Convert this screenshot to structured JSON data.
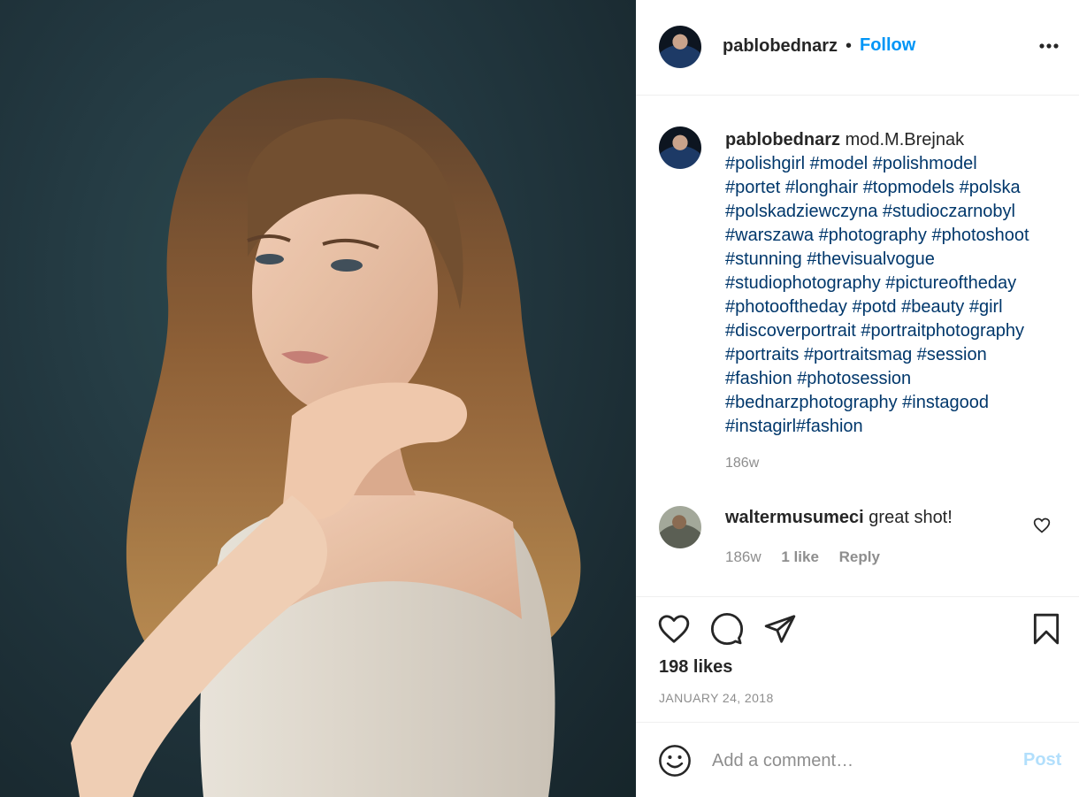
{
  "post": {
    "username": "pablobednarz",
    "separator": "•",
    "follow_label": "Follow",
    "more_icon": "more-horizontal-icon"
  },
  "caption": {
    "username": "pablobednarz",
    "text": "mod.M.Brejnak",
    "tags": [
      "#polishgirl",
      "#model",
      "#polishmodel",
      "#portet",
      "#longhair",
      "#topmodels",
      "#polska",
      "#polskadziewczyna",
      "#studioczarnobyl",
      "#warszawa",
      "#photography",
      "#photoshoot",
      "#stunning",
      "#thevisualvogue",
      "#studiophotography",
      "#pictureoftheday",
      "#photooftheday",
      "#potd",
      "#beauty",
      "#girl",
      "#discoverportrait",
      "#portraitphotography",
      "#portraits",
      "#portraitsmag",
      "#session",
      "#fashion",
      "#photosession",
      "#bednarzphotography",
      "#instagood",
      "#instagirl",
      "#fashion"
    ],
    "time": "186w"
  },
  "comments": [
    {
      "username": "waltermusumeci",
      "text": "great shot!",
      "time": "186w",
      "likes": "1 like",
      "reply_label": "Reply"
    }
  ],
  "actions": {
    "icons": [
      "heart-icon",
      "comment-icon",
      "share-icon",
      "bookmark-icon"
    ]
  },
  "likes": "198 likes",
  "date": "JANUARY 24, 2018",
  "add_comment": {
    "placeholder": "Add a comment…",
    "post_label": "Post"
  }
}
